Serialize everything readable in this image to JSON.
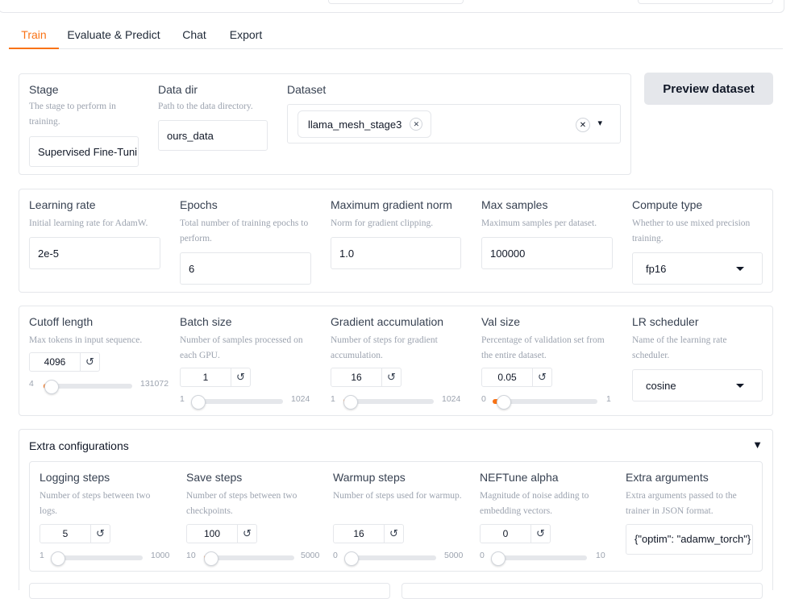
{
  "tabs": [
    "Train",
    "Evaluate & Predict",
    "Chat",
    "Export"
  ],
  "stage": {
    "label": "Stage",
    "info": "The stage to perform in training.",
    "value": "Supervised Fine-Tuning"
  },
  "data_dir": {
    "label": "Data dir",
    "info": "Path to the data directory.",
    "value": "ours_data"
  },
  "dataset": {
    "label": "Dataset",
    "chip": "llama_mesh_stage3",
    "clear_icon": "✕",
    "caret_icon": "▾"
  },
  "preview_button": "Preview dataset",
  "learning_rate": {
    "label": "Learning rate",
    "info": "Initial learning rate for AdamW.",
    "value": "2e-5"
  },
  "epochs": {
    "label": "Epochs",
    "info": "Total number of training epochs to perform.",
    "value": "6"
  },
  "max_grad_norm": {
    "label": "Maximum gradient norm",
    "info": "Norm for gradient clipping.",
    "value": "1.0"
  },
  "max_samples": {
    "label": "Max samples",
    "info": "Maximum samples per dataset.",
    "value": "100000"
  },
  "compute_type": {
    "label": "Compute type",
    "info": "Whether to use mixed precision training.",
    "value": "fp16"
  },
  "cutoff_len": {
    "label": "Cutoff length",
    "info": "Max tokens in input sequence.",
    "value": "4096",
    "min": "4",
    "max": "131072",
    "fraction": 0.031
  },
  "batch_size": {
    "label": "Batch size",
    "info": "Number of samples processed on each GPU.",
    "value": "1",
    "min": "1",
    "max": "1024",
    "fraction": 0.0
  },
  "grad_accum": {
    "label": "Gradient accumulation",
    "info": "Number of steps for gradient accumulation.",
    "value": "16",
    "min": "1",
    "max": "1024",
    "fraction": 0.015
  },
  "val_size": {
    "label": "Val size",
    "info": "Percentage of validation set from the entire dataset.",
    "value": "0.05",
    "min": "0",
    "max": "1",
    "fraction": 0.05
  },
  "lr_scheduler": {
    "label": "LR scheduler",
    "info": "Name of the learning rate scheduler.",
    "value": "cosine"
  },
  "extra": {
    "title": "Extra configurations",
    "toggle_icon": "▼"
  },
  "logging_steps": {
    "label": "Logging steps",
    "info": "Number of steps between two logs.",
    "value": "5",
    "min": "1",
    "max": "1000",
    "fraction": 0.004
  },
  "save_steps": {
    "label": "Save steps",
    "info": "Number of steps between two checkpoints.",
    "value": "100",
    "min": "10",
    "max": "5000",
    "fraction": 0.018
  },
  "warmup_steps": {
    "label": "Warmup steps",
    "info": "Number of steps used for warmup.",
    "value": "16",
    "min": "0",
    "max": "5000",
    "fraction": 0.003
  },
  "neftune": {
    "label": "NEFTune alpha",
    "info": "Magnitude of noise adding to embedding vectors.",
    "value": "0",
    "min": "0",
    "max": "10",
    "fraction": 0.0
  },
  "extra_args": {
    "label": "Extra arguments",
    "info": "Extra arguments passed to the trainer in JSON format.",
    "value": "{\"optim\": \"adamw_torch\"}"
  },
  "reset_icon": "↺",
  "accent_color": "#f97316"
}
